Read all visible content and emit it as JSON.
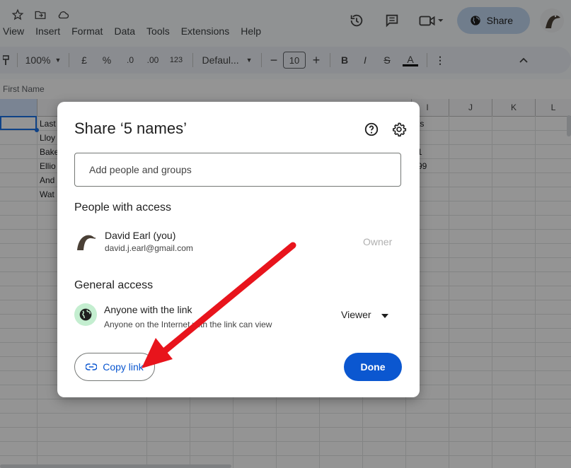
{
  "menu": [
    "View",
    "Insert",
    "Format",
    "Data",
    "Tools",
    "Extensions",
    "Help"
  ],
  "toolbar": {
    "zoom": "100%",
    "currency": "£",
    "percent": "%",
    "decimal_decrease": ".0",
    "decimal_increase": ".00",
    "number_format": "123",
    "font": "Defaul...",
    "font_size": "10",
    "bold": "B",
    "italic": "I",
    "strike": "S",
    "text_color": "A",
    "more": "⋮"
  },
  "top_actions": {
    "share_label": "Share"
  },
  "formula_bar": {
    "cell_value": "First Name"
  },
  "sheet": {
    "columns": [
      "I",
      "J",
      "K",
      "L"
    ],
    "cells_col_b": [
      "Last",
      "Lloy",
      "Bake",
      "Ellio",
      "And",
      "Wat"
    ],
    "cells_col_h": [
      "ts",
      "",
      "1",
      "99"
    ]
  },
  "dialog": {
    "title": "Share ‘5 names’",
    "add_placeholder": "Add people and groups",
    "people_section": "People with access",
    "person": {
      "name": "David Earl (you)",
      "email": "david.j.earl@gmail.com",
      "role": "Owner"
    },
    "general_section": "General access",
    "access": {
      "title": "Anyone with the link",
      "description": "Anyone on the Internet with the link can view",
      "level": "Viewer"
    },
    "copy_link_label": "Copy link",
    "done_label": "Done"
  },
  "colors": {
    "primary": "#0b57d0",
    "arrow": "#e8141c",
    "globe_bg": "#c4eed0"
  }
}
